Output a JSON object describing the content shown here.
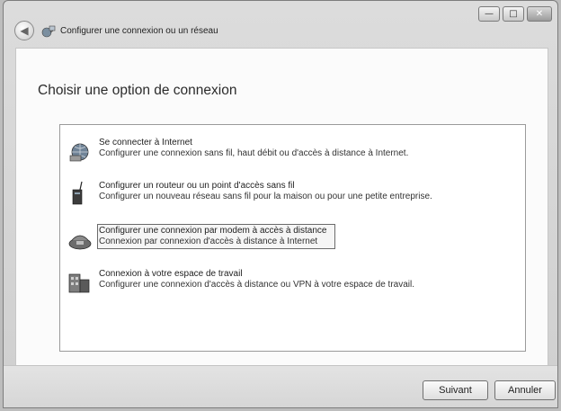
{
  "window": {
    "title": "Configurer une connexion ou un réseau",
    "controls": {
      "minimize": "—",
      "maximize": "□",
      "close": "✕"
    }
  },
  "page": {
    "heading": "Choisir une option de connexion"
  },
  "options": [
    {
      "icon": "internet-globe-icon",
      "title": "Se connecter à Internet",
      "description": "Configurer une connexion sans fil, haut débit ou d'accès à distance à Internet.",
      "selected": false
    },
    {
      "icon": "router-antenna-icon",
      "title": "Configurer un routeur ou un point d'accès sans fil",
      "description": "Configurer un nouveau réseau sans fil pour la maison ou pour une petite entreprise.",
      "selected": false
    },
    {
      "icon": "modem-phone-icon",
      "title": "Configurer une connexion par modem à accès à distance",
      "description": "Connexion par connexion d'accès à distance à Internet",
      "selected": true
    },
    {
      "icon": "workplace-building-icon",
      "title": "Connexion à votre espace de travail",
      "description": "Configurer une connexion d'accès à distance ou VPN à votre espace de travail.",
      "selected": false
    }
  ],
  "buttons": {
    "next": "Suivant",
    "cancel": "Annuler"
  }
}
